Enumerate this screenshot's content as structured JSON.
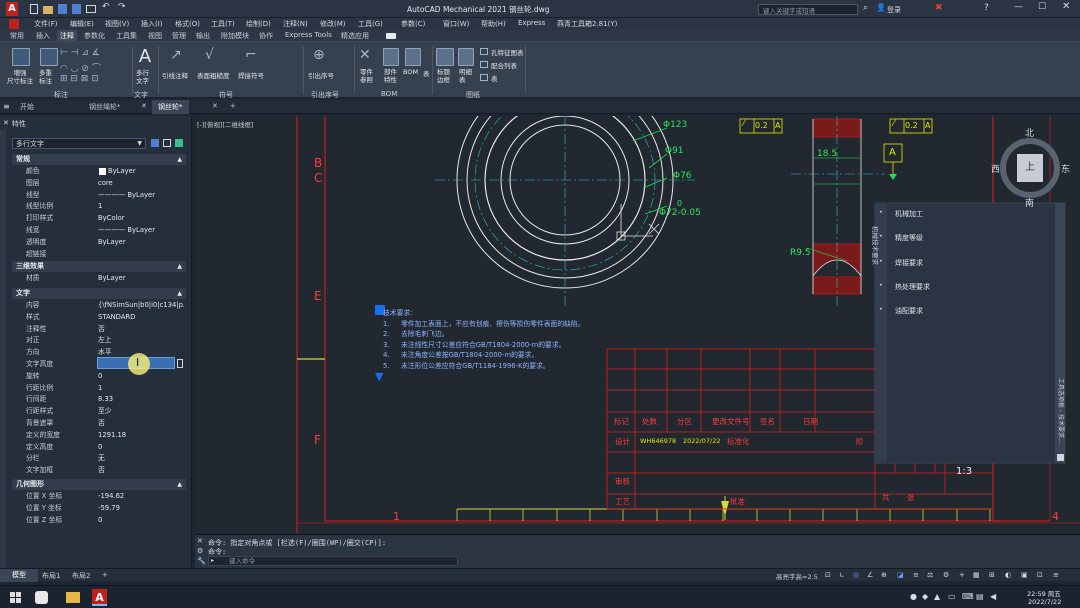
{
  "app": {
    "title": "AutoCAD Mechanical 2021    钢丝轮.dwg",
    "search_placeholder": "键入关键字或短语",
    "login_label": "登录"
  },
  "menu": [
    "文件(F)",
    "编辑(E)",
    "视图(V)",
    "插入(I)",
    "格式(O)",
    "工具(T)",
    "绘制(D)",
    "注释(N)",
    "修改(M)",
    "工具(G)",
    "参数(C)",
    "窗口(W)",
    "帮助(H)",
    "Express",
    "燕青工具箱2.81(Y)"
  ],
  "ribbon_tabs": [
    "常用",
    "插入",
    "注释",
    "参数化",
    "工具集",
    "视图",
    "管理",
    "输出",
    "附加模块",
    "协作",
    "Express Tools",
    "精选应用"
  ],
  "ribbon_active_tab": "注释",
  "ribbon": {
    "buttons": [
      {
        "label": "増强\n尺寸标注"
      },
      {
        "label": "多重\n标注"
      },
      {
        "label": "多行\n文字"
      },
      {
        "label": "引线注释"
      },
      {
        "label": "表面粗糙度"
      },
      {
        "label": "焊接符号"
      },
      {
        "label": "引出序号"
      },
      {
        "label": "零件\n参照"
      },
      {
        "label": "部件\n特性"
      },
      {
        "label": "BOM"
      },
      {
        "label": "表"
      },
      {
        "label": "标题\n边框"
      },
      {
        "label": "明细\n表"
      }
    ],
    "side_items": [
      "孔特征图表",
      "配合列表",
      "表"
    ],
    "groups": [
      "标注",
      "文字",
      "符号",
      "引出序号",
      "BOM",
      "图纸"
    ]
  },
  "doc_tabs": [
    "开始",
    "钢丝绳轮*",
    "钢丝轮*"
  ],
  "palette": {
    "title": "特性",
    "object_type": "多行文字",
    "sections": {
      "general": "常规",
      "three_d": "三维效果",
      "text": "文字",
      "geometry": "几何图形"
    },
    "general": [
      {
        "name": "颜色",
        "value": "ByLayer"
      },
      {
        "name": "图层",
        "value": "core"
      },
      {
        "name": "线型",
        "value": "———— ByLayer"
      },
      {
        "name": "线型比例",
        "value": "1"
      },
      {
        "name": "打印样式",
        "value": "ByColor"
      },
      {
        "name": "线宽",
        "value": "———— ByLayer"
      },
      {
        "name": "透明度",
        "value": "ByLayer"
      },
      {
        "name": "超链接",
        "value": ""
      }
    ],
    "three_d": [
      {
        "name": "材质",
        "value": "ByLayer"
      }
    ],
    "text": [
      {
        "name": "内容",
        "value": "{\\fNSimSun|b0|i0|c134|p..."
      },
      {
        "name": "样式",
        "value": "STANDARD"
      },
      {
        "name": "注释性",
        "value": "否"
      },
      {
        "name": "对正",
        "value": "左上"
      },
      {
        "name": "方向",
        "value": "水平"
      },
      {
        "name": "文字高度",
        "value": "7"
      },
      {
        "name": "旋转",
        "value": "0"
      },
      {
        "name": "行距比例",
        "value": "1"
      },
      {
        "name": "行间距",
        "value": "8.33"
      },
      {
        "name": "行距样式",
        "value": "至少"
      },
      {
        "name": "背景遮罩",
        "value": "否"
      },
      {
        "name": "定义的宽度",
        "value": "1291.18"
      },
      {
        "name": "定义高度",
        "value": "0"
      },
      {
        "name": "分栏",
        "value": "无"
      },
      {
        "name": "文字加框",
        "value": "否"
      }
    ],
    "geometry": [
      {
        "name": "位置 X 坐标",
        "value": "-194.62"
      },
      {
        "name": "位置 Y 坐标",
        "value": "-59.79"
      },
      {
        "name": "位置 Z 坐标",
        "value": "0"
      }
    ]
  },
  "canvas": {
    "view_label": "[-][俯视][二维线框]",
    "dims": {
      "d123": "Φ123",
      "d91": "Φ91",
      "d76": "Φ76",
      "d72": "Φ72-0.05",
      "tol": "0",
      "d185": "18.5",
      "r95": "R9.5",
      "datum": "A",
      "tol_a": "0.2",
      "tol_b": "0.2",
      "datum_a2": "A"
    },
    "zone_letters": [
      "B",
      "C",
      "E",
      "F"
    ],
    "zone_numbers": [
      "1",
      "4"
    ],
    "tech_title": "技术要求:",
    "tech_items": [
      {
        "no": "1.",
        "text": "零件加工表面上，不应有划痕、擦伤等损伤零件表面的缺陷。"
      },
      {
        "no": "2.",
        "text": "去除毛刺飞边。"
      },
      {
        "no": "3.",
        "text": "未注线性尺寸公差应符合GB/T1804-2000-m的要求。"
      },
      {
        "no": "4.",
        "text": "未注角度公差按GB/T1804-2000-m的要求。"
      },
      {
        "no": "5.",
        "text": "未注形位公差应符合GB/T1184-1996-K的要求。"
      }
    ],
    "title_block": {
      "row1": [
        "标记",
        "处数",
        "分区",
        "更改文件号",
        "签名",
        "日期"
      ],
      "row2": [
        "设计",
        "WH646978",
        "2022/07/22",
        "标准化"
      ],
      "review": "审核",
      "craft": "工艺",
      "approve": "批准",
      "scale": "1:3",
      "part_a": "共",
      "part_b": "张",
      "part_c": "阶"
    },
    "viewcube": {
      "n": "北",
      "s": "南",
      "w": "西",
      "e": "东",
      "top": "上"
    },
    "tool_palette": {
      "vertical_label": "机械技术要求",
      "items": [
        "机械加工",
        "精度等级",
        "焊接要求",
        "热处理要求",
        "油配要求"
      ],
      "side_label": "工具选项板 - 技术要求..."
    }
  },
  "command": {
    "history": [
      "命令: 指定对角点或 [栏选(F)/圈围(WP)/圈交(CP)]:",
      "命令:"
    ],
    "placeholder": "键入命令"
  },
  "layout_tabs": [
    "模型",
    "布局1",
    "布局2"
  ],
  "status": {
    "text_height": "高亮字高=2.5"
  },
  "taskbar": {
    "time": "22:59 周五",
    "date": "2022/7/22"
  }
}
